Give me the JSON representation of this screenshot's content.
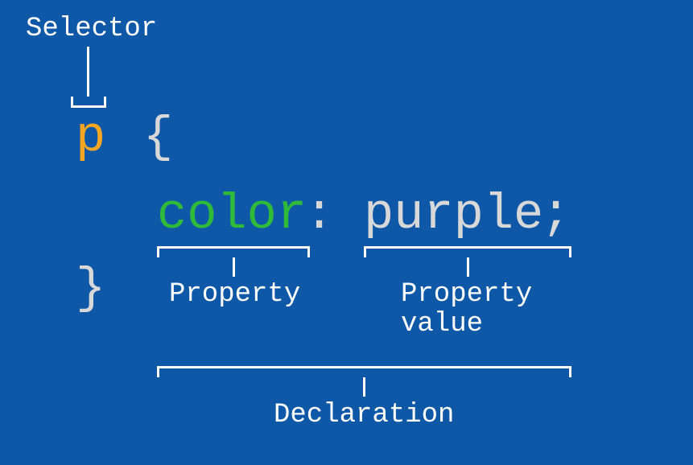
{
  "labels": {
    "selector": "Selector",
    "property": "Property",
    "property_value": "Property\nvalue",
    "declaration": "Declaration"
  },
  "code": {
    "selector": "p",
    "open_brace": "{",
    "property": "color",
    "colon": ":",
    "value": "purple",
    "semicolon": ";",
    "close_brace": "}"
  },
  "colors": {
    "background": "#0f58a8",
    "label": "#ffffff",
    "selector": "#f5a623",
    "property": "#2fba3a",
    "value_and_punct": "#d8d8d8"
  }
}
